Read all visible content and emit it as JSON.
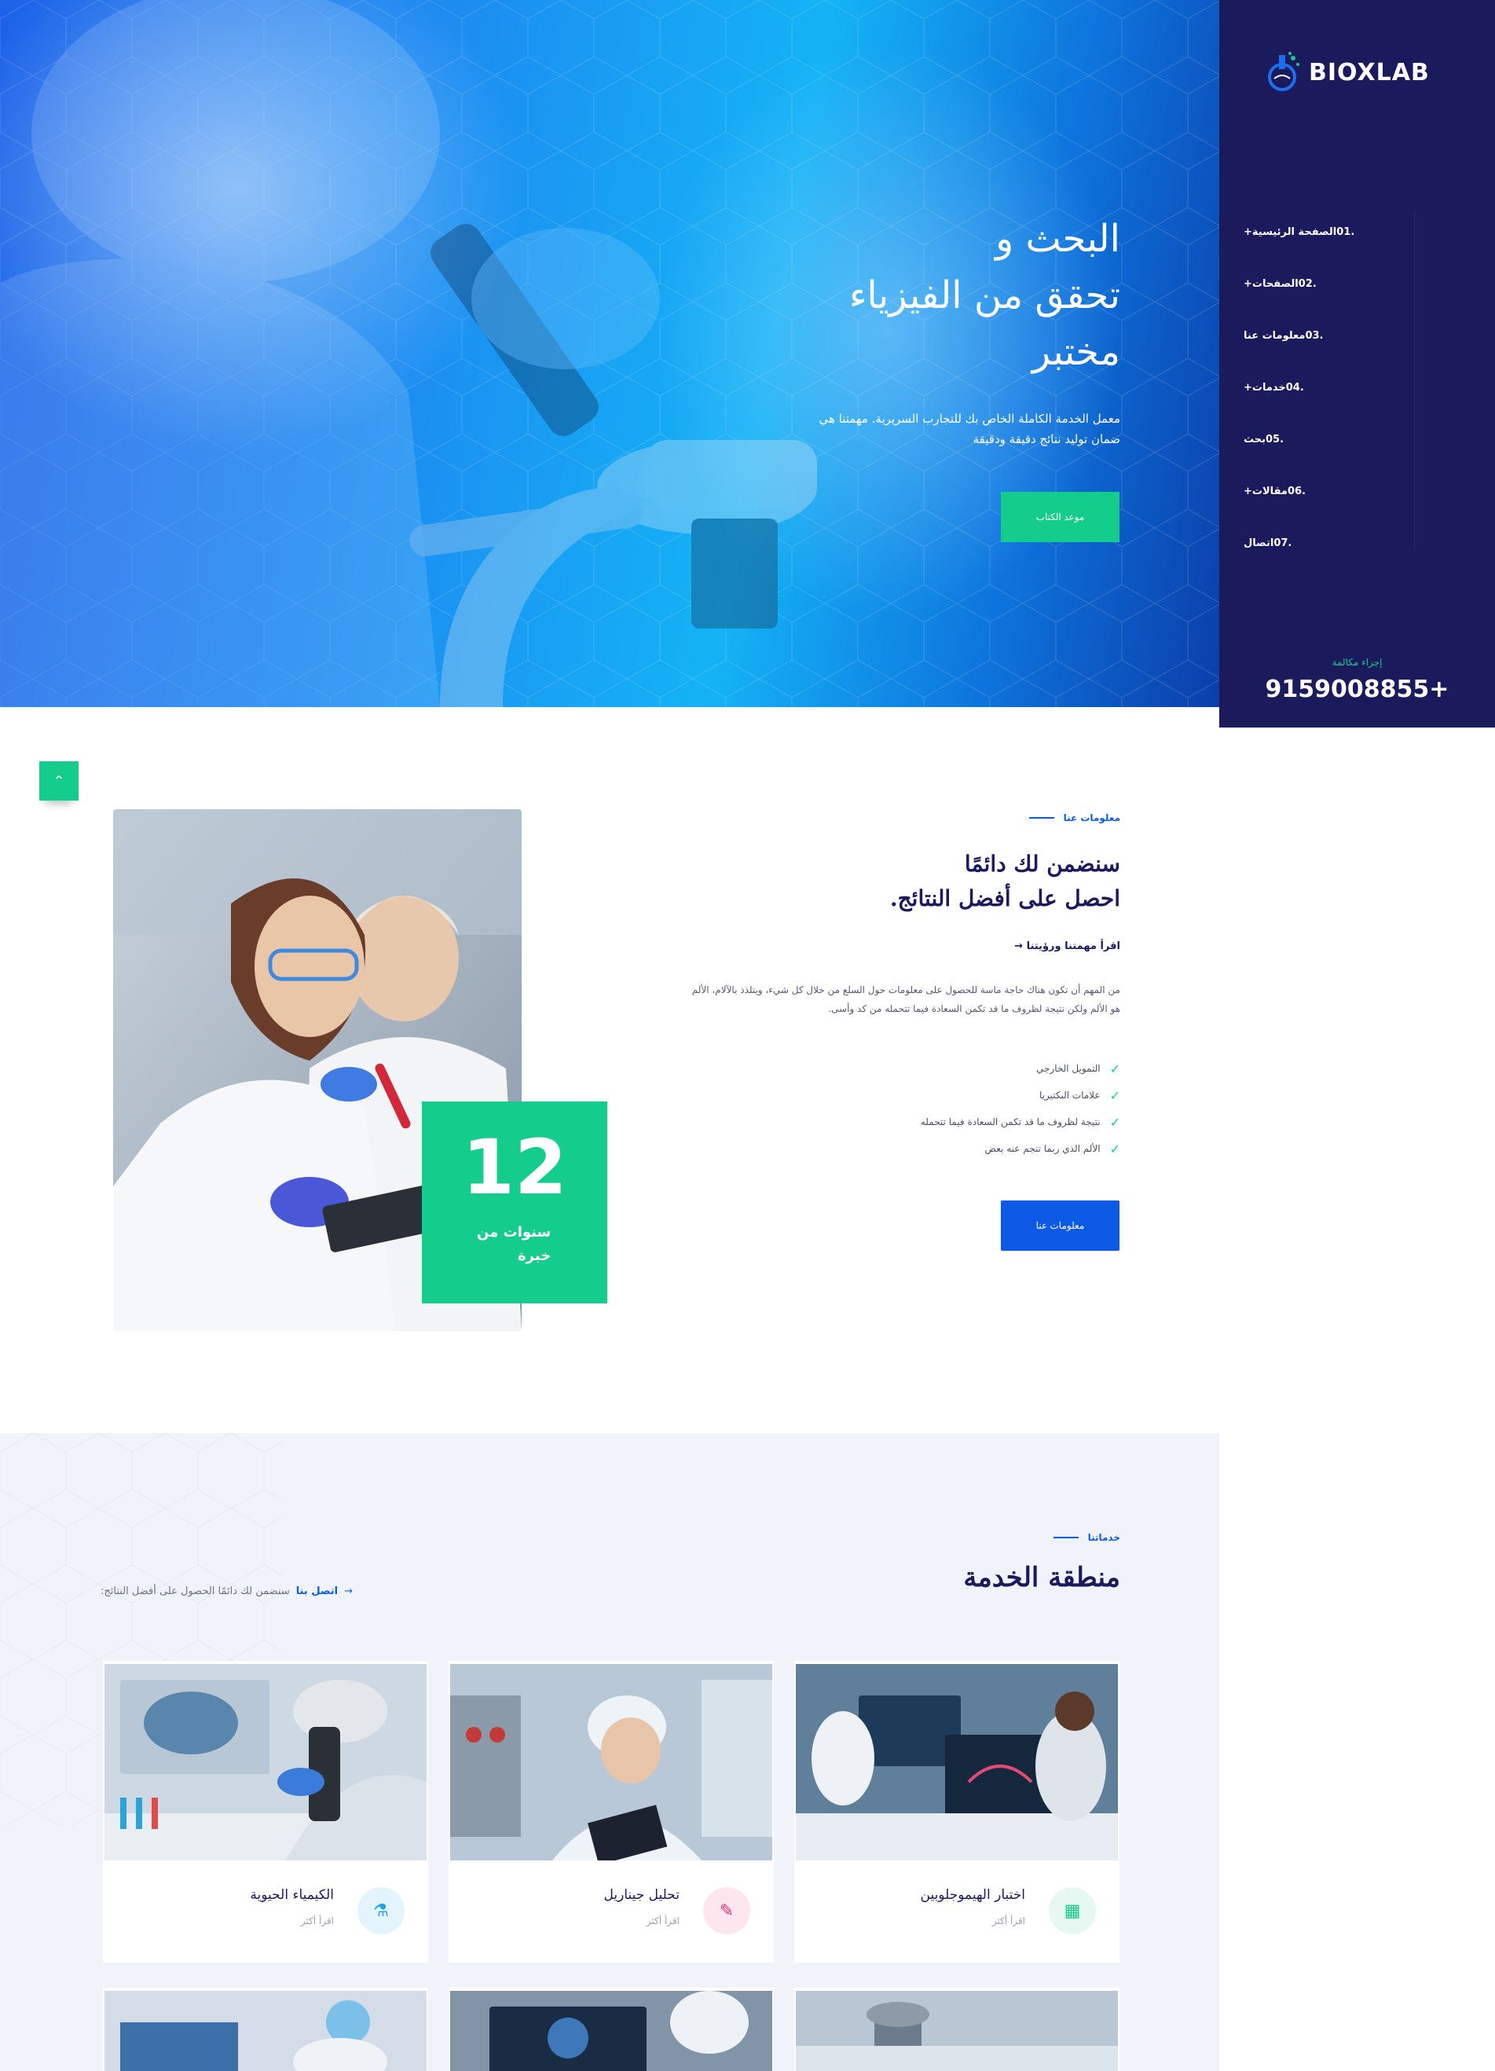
{
  "brand": {
    "name": "BIOXLAB",
    "accent_green": "#14cc8c",
    "accent_blue": "#0c5ae6",
    "navy": "#1b1a5c"
  },
  "hero": {
    "title_lines": [
      "البحث و",
      "تحقق من الفيزياء",
      "مختبر"
    ],
    "text": "معمل الخدمة الكاملة الخاص بك للتجارب السريرية. مهمتنا هي ضمان توليد نتائج دقيقة ودقيقة",
    "button": "موعد الكتاب"
  },
  "nav": {
    "items": [
      {
        "num": ".01",
        "label": "الصفحة الرئيسية+"
      },
      {
        "num": ".02",
        "label": "الصفحات+"
      },
      {
        "num": ".03",
        "label": "معلومات عنا"
      },
      {
        "num": ".04",
        "label": "خدمات+"
      },
      {
        "num": ".05",
        "label": "بحث"
      },
      {
        "num": ".06",
        "label": "مقالات+"
      },
      {
        "num": ".07",
        "label": "اتصال"
      }
    ],
    "call_label": "إجراء مكالمة",
    "call_number": "9159008855+"
  },
  "about": {
    "tag": "معلومات عنا",
    "title_lines": [
      "سنضمن لك دائمًا",
      "احصل على أفضل النتائج."
    ],
    "read_link": "اقرأ مهمتنا ورؤيتنا",
    "paragraph": "من المهم أن تكون هناك حاجة ماسة للحصول على معلومات حول السلع من خلال كل شيء، ويتلذذ بالآلام، الألم هو الألم ولكن نتيجة لظروف ما قد تكمن السعادة فيما تتحمله من كد وأسى.",
    "checklist": [
      "التمويل الخارجي",
      "علامات البكتيريا",
      "نتيجة لظروف ما قد تكمن السعادة فيما تتحمله",
      "الألم الذي ربما تنجم عنه بعض"
    ],
    "experience_number": "12",
    "experience_label_lines": [
      "سنوات من",
      "خبرة"
    ],
    "button": "معلومات عنا"
  },
  "services": {
    "tag": "خدماتنا",
    "title": "منطقة الخدمة",
    "contact_text": "سنضمن لك دائمًا الحصول على أفضل النتائج:",
    "contact_link": "اتصل بنا",
    "cards": [
      {
        "title": "اختبار الهيموجلوبين",
        "more": "اقرأ أكثر",
        "icon": "calculator-icon",
        "icon_color": "#14cc8c"
      },
      {
        "title": "تحليل جيناريل",
        "more": "اقرأ أكثر",
        "icon": "pencil-icon",
        "icon_color": "#e8336b"
      },
      {
        "title": "الكيمياء الحيوية",
        "more": "اقرأ أكثر",
        "icon": "flask-icon",
        "icon_color": "#1ca3e6"
      }
    ]
  }
}
